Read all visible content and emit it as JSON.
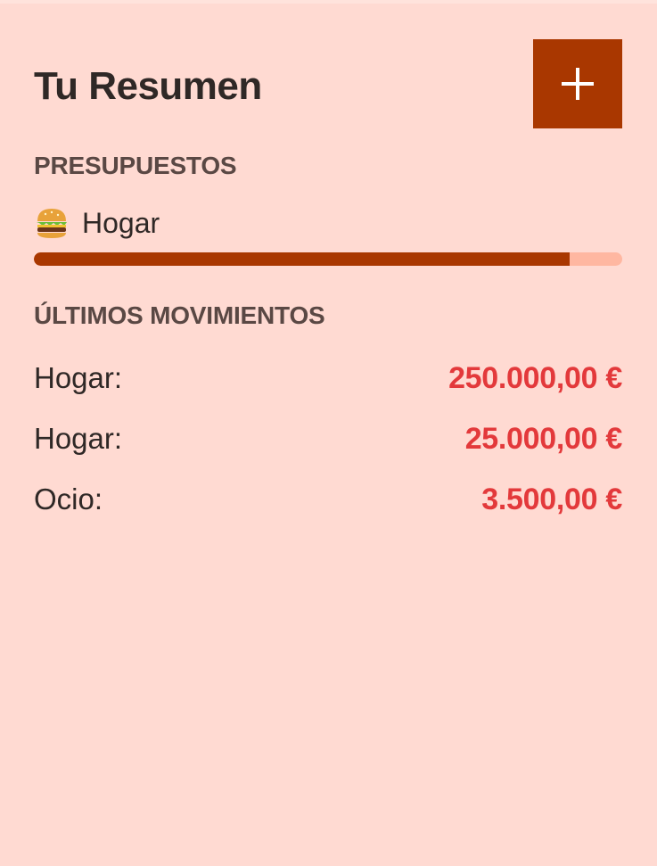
{
  "header": {
    "title": "Tu Resumen",
    "add_button_icon": "plus-icon"
  },
  "budgets": {
    "section_title": "PRESUPUESTOS",
    "items": [
      {
        "icon": "hamburger-emoji",
        "label": "Hogar",
        "progress_fraction": 0.91
      }
    ]
  },
  "movements": {
    "section_title": "ÚLTIMOS MOVIMIENTOS",
    "items": [
      {
        "label": "Hogar:",
        "amount": "250.000,00 €"
      },
      {
        "label": "Hogar:",
        "amount": "25.000,00 €"
      },
      {
        "label": "Ocio:",
        "amount": "3.500,00 €"
      }
    ]
  },
  "colors": {
    "background": "#ffdad2",
    "accent": "#a93700",
    "progress_track": "#ffb7a1",
    "amount": "#e3393b"
  }
}
